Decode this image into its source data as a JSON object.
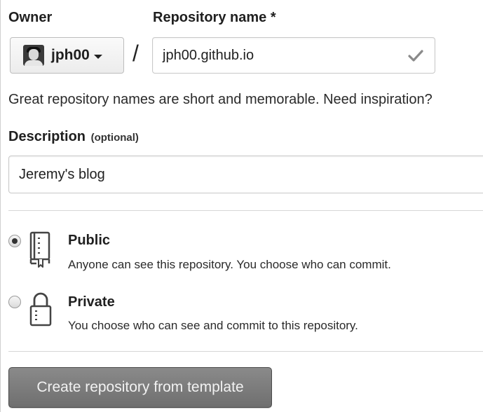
{
  "owner": {
    "label": "Owner",
    "value": "jph00"
  },
  "repository": {
    "label": "Repository name *",
    "separator": "/",
    "value": "jph00.github.io"
  },
  "hint": "Great repository names are short and memorable. Need inspiration?",
  "description": {
    "label": "Description",
    "optional": "(optional)",
    "value": "Jeremy's blog"
  },
  "visibility": {
    "selected": "public",
    "options": [
      {
        "id": "public",
        "title": "Public",
        "description": "Anyone can see this repository. You choose who can commit.",
        "icon": "repo-book-icon"
      },
      {
        "id": "private",
        "title": "Private",
        "description": "You choose who can see and commit to this repository.",
        "icon": "lock-icon"
      }
    ]
  },
  "submit": {
    "label": "Create repository from template"
  },
  "colors": {
    "button_bg": "#7d7d7d",
    "button_text": "#f2f2f2",
    "border": "#c8c8c8"
  }
}
